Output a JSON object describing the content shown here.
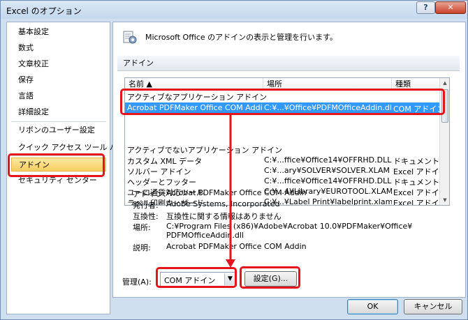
{
  "window": {
    "title": "Excel のオプション",
    "help_label": "?",
    "close_label": "✕"
  },
  "sidebar": {
    "items": [
      {
        "label": "基本設定"
      },
      {
        "label": "数式"
      },
      {
        "label": "文章校正"
      },
      {
        "label": "保存"
      },
      {
        "label": "言語"
      },
      {
        "label": "詳細設定"
      },
      {
        "label": "リボンのユーザー設定"
      },
      {
        "label": "クイック アクセス ツール バー"
      },
      {
        "label": "アドイン",
        "selected": true
      },
      {
        "label": "セキュリティ センター"
      }
    ]
  },
  "main": {
    "header_text": "Microsoft Office のアドインの表示と管理を行います。",
    "section_title": "アドイン",
    "table": {
      "columns": [
        "名前 ▲",
        "場所",
        "種類"
      ],
      "active_group": "アクティブなアプリケーション アドイン",
      "active_rows": [
        {
          "name": "Acrobat PDFMaker Office COM Addin",
          "location": "C:¥...¥Office¥PDFMOfficeAddin.dll",
          "type": "COM アドイン"
        }
      ],
      "inactive_group": "アクティブでないアプリケーション アドイン",
      "inactive_rows": [
        {
          "name": "カスタム XML データ",
          "location": "C:¥...ffice¥Office14¥OFFRHD.DLL",
          "type": "ドキュメント検査"
        },
        {
          "name": "ソルバー アドイン",
          "location": "C:¥...ary¥SOLVER¥SOLVER.XLAM",
          "type": "Excel アドイン"
        },
        {
          "name": "ヘッダーとフッター",
          "location": "C:¥...ffice¥Office14¥OFFRHD.DLL",
          "type": "ドキュメント検査"
        },
        {
          "name": "ユーロ通貨対応ツール",
          "location": "C:¥...4¥Library¥EUROTOOL.XLAM",
          "type": "Excel アドイン"
        },
        {
          "name": "ラベル印刷ウィザード",
          "location": "C:¥...¥Label Print¥labelprint.xlam",
          "type": "Excel アドイン"
        }
      ]
    },
    "details": {
      "addin_label": "アドイン:",
      "addin_value": "Acrobat PDFMaker Office COM Addin",
      "publisher_label": "発行者:",
      "publisher_value": "Adobe Systems, Incorporated",
      "compat_label": "互換性:",
      "compat_value": "互換性に関する情報はありません",
      "location_label": "場所:",
      "location_value_1": "C:¥Program Files (x86)¥Adobe¥Acrobat 10.0¥PDFMaker¥Office¥",
      "location_value_2": "PDFMOfficeAddin.dll",
      "desc_label": "説明:",
      "desc_value": "Acrobat PDFMaker Office COM Addin"
    },
    "manage_label": "管理(A):",
    "manage_selected": "COM アドイン",
    "go_button": "設定(G)..."
  },
  "footer": {
    "ok": "OK",
    "cancel": "キャンセル"
  },
  "colors": {
    "highlight": "#e5141b",
    "selection": "#3399ff",
    "selected_nav": "#f7cd62"
  }
}
